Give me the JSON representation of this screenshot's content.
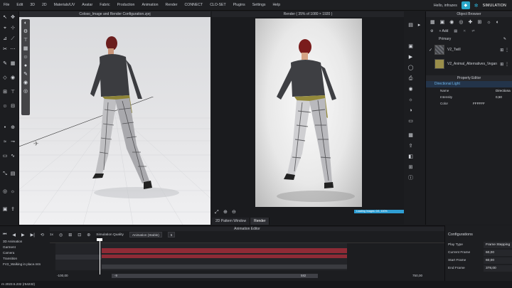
{
  "menu": [
    "File",
    "Edit",
    "3D",
    "2D",
    "Materials/UV",
    "Avatar",
    "Fabric",
    "Production",
    "Animation",
    "Render",
    "CONNECT",
    "CLO-SET",
    "Plugins",
    "Settings",
    "Help"
  ],
  "header": {
    "user": "Hello, infrazes",
    "mode": "SIMULATION"
  },
  "viewport": {
    "title": "Coloso_Image and Render Configuration.zprj"
  },
  "render": {
    "title": "Render ( 35% of 1080 × 1920 )",
    "progress_text": "Loading Images: 0/1, 100%",
    "tabs": [
      "2D Pattern Window",
      "Render"
    ],
    "active_tab": "Render"
  },
  "object_browser": {
    "title": "Object Browser",
    "add_label": "+ Add",
    "section": "Primary",
    "fabrics": [
      {
        "name": "V2_Twill",
        "swatch": "#5f6166"
      },
      {
        "name": "V2_Animal_Alternatives_Vegan",
        "swatch": "#9a8e4a"
      }
    ]
  },
  "property_editor": {
    "title": "Property Editor",
    "header": "Directional Light",
    "rows": [
      {
        "label": "Name",
        "value": "Directiona"
      },
      {
        "label": "Intensity",
        "value": "0,50"
      },
      {
        "label": "Color",
        "value": "FFFFFF"
      }
    ]
  },
  "animation_editor": {
    "title": "Animation Editor",
    "simulation_quality_label": "Simulation Quality",
    "simulation_quality_value": "Animation (Stable)",
    "speed_label": "1x",
    "fps_value": "5",
    "tracks": [
      "3D Animation",
      "Garment",
      "Camera",
      "Transition",
      "FV2_Walking in place.mtn"
    ],
    "range_start": "-100,00",
    "range_end": "750,00",
    "range_bar_start": "-9",
    "range_bar_end": "582"
  },
  "configurations": {
    "title": "Configurations",
    "rows": [
      {
        "label": "Play Type",
        "value": "Frame Stepping"
      },
      {
        "label": "Current Frame",
        "value": "60,00"
      },
      {
        "label": "Start Frame",
        "value": "60,00"
      },
      {
        "label": "End Frame",
        "value": "378,00"
      }
    ]
  },
  "status": {
    "text": "rn 2023.5.232 (r54232)"
  }
}
